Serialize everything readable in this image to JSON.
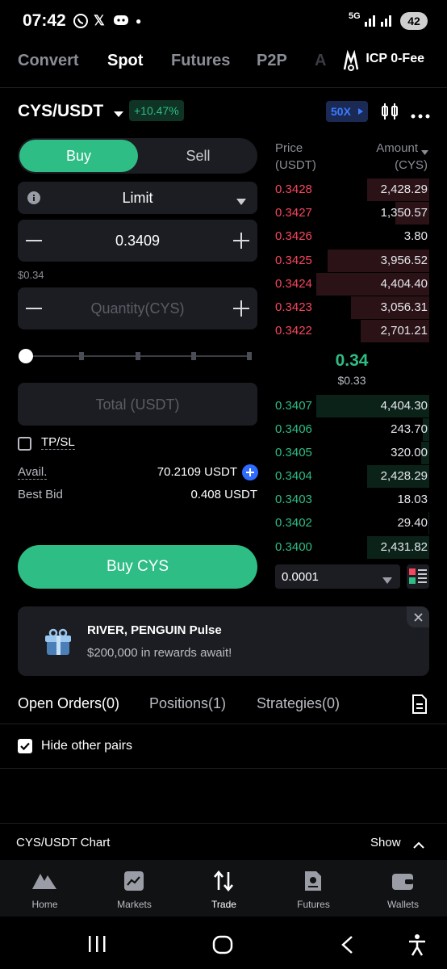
{
  "status_bar": {
    "time": "07:42",
    "notification_icons": [
      "whatsapp-icon",
      "x-icon",
      "discord-icon",
      "dot-icon"
    ],
    "network": "5G",
    "battery": "42"
  },
  "top_tabs": {
    "items": [
      "Convert",
      "Spot",
      "Futures",
      "P2P",
      "A"
    ],
    "active": "Spot",
    "promo": "ICP 0-Fee"
  },
  "pair": {
    "symbol": "CYS/USDT",
    "change": "+10.47%",
    "leverage": "50X"
  },
  "order_form": {
    "side_buy": "Buy",
    "side_sell": "Sell",
    "order_type": "Limit",
    "price_value": "0.3409",
    "price_usd": "$0.34",
    "quantity_placeholder": "Quantity(CYS)",
    "slider_level": 0,
    "total_placeholder": "Total (USDT)",
    "tpsl_label": "TP/SL",
    "avail_label": "Avail.",
    "avail_value": "70.2109 USDT",
    "best_bid_label": "Best Bid",
    "best_bid_value": "0.408 USDT",
    "submit_label": "Buy CYS"
  },
  "order_book": {
    "price_header": "Price",
    "price_unit": "(USDT)",
    "amount_header": "Amount",
    "amount_unit": "(CYS)",
    "asks": [
      {
        "price": "0.3428",
        "amount": "2,428.29",
        "depth": 0.55
      },
      {
        "price": "0.3427",
        "amount": "1,350.57",
        "depth": 0.3
      },
      {
        "price": "0.3426",
        "amount": "3.80",
        "depth": 0.0
      },
      {
        "price": "0.3425",
        "amount": "3,956.52",
        "depth": 0.9
      },
      {
        "price": "0.3424",
        "amount": "4,404.40",
        "depth": 1.0
      },
      {
        "price": "0.3423",
        "amount": "3,056.31",
        "depth": 0.69
      },
      {
        "price": "0.3422",
        "amount": "2,701.21",
        "depth": 0.61
      }
    ],
    "last_price": "0.34",
    "last_price_usd": "$0.33",
    "bids": [
      {
        "price": "0.3407",
        "amount": "4,404.30",
        "depth": 1.0
      },
      {
        "price": "0.3406",
        "amount": "243.70",
        "depth": 0.06
      },
      {
        "price": "0.3405",
        "amount": "320.00",
        "depth": 0.07
      },
      {
        "price": "0.3404",
        "amount": "2,428.29",
        "depth": 0.55
      },
      {
        "price": "0.3403",
        "amount": "18.03",
        "depth": 0.0
      },
      {
        "price": "0.3402",
        "amount": "29.40",
        "depth": 0.01
      },
      {
        "price": "0.3400",
        "amount": "2,431.82",
        "depth": 0.55
      }
    ],
    "precision": "0.0001",
    "colors": {
      "ask": "#f6465d",
      "bid": "#2ebd85",
      "ask_bar": "#2a1216",
      "bid_bar": "#0b2219"
    }
  },
  "banner": {
    "title": "RIVER, PENGUIN Pulse",
    "subtitle": "$200,000 in rewards await!"
  },
  "orders_tabs": {
    "items": [
      "Open Orders(0)",
      "Positions(1)",
      "Strategies(0)"
    ],
    "active": "Open Orders(0)",
    "hide_other_pairs": "Hide other pairs"
  },
  "chart_bar": {
    "label": "CYS/USDT Chart",
    "action": "Show"
  },
  "bottom_nav": {
    "items": [
      "Home",
      "Markets",
      "Trade",
      "Futures",
      "Wallets"
    ],
    "active": "Trade"
  }
}
